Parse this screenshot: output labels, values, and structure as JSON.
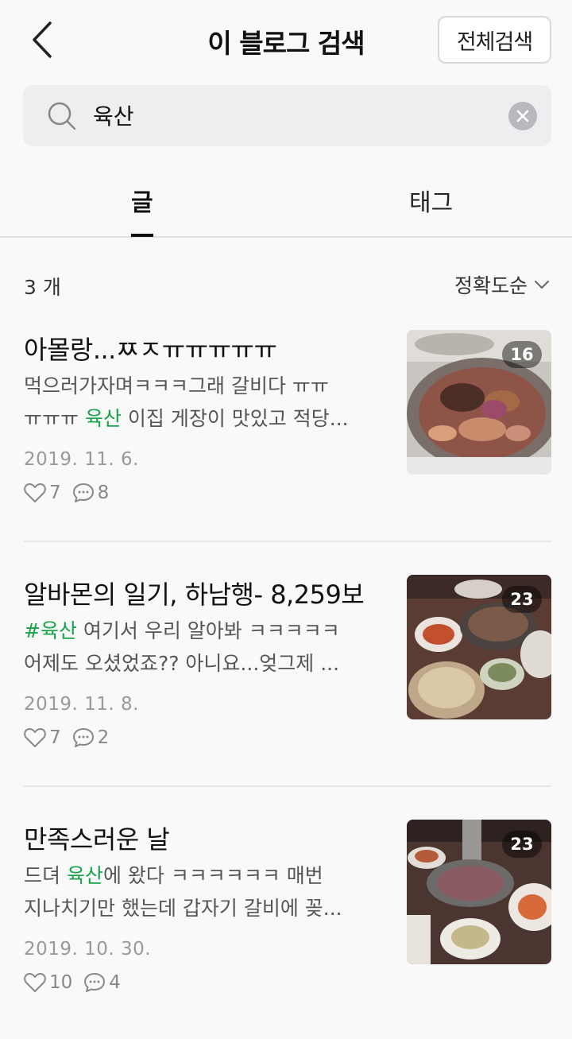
{
  "header": {
    "title": "이 블로그 검색",
    "all_search_label": "전체검색"
  },
  "search": {
    "query": "육산",
    "placeholder": ""
  },
  "tabs": [
    {
      "label": "글",
      "active": true
    },
    {
      "label": "태그",
      "active": false
    }
  ],
  "results": {
    "count_label": "3 개",
    "sort_label": "정확도순"
  },
  "posts": [
    {
      "title": "아몰랑...ㅉㅈㅠㅠㅠㅠㅠ",
      "snippet_line1": "먹으러가자며ㅋㅋㅋ그래 갈비다 ㅠㅠ",
      "snippet_line2_pre": "ㅠㅠㅠ ",
      "snippet_line2_hl": "육산",
      "snippet_line2_post": " 이집 게장이 맛있고 적당...",
      "date": "2019. 11. 6.",
      "likes": "7",
      "comments": "8",
      "photo_count": "16"
    },
    {
      "title": "알바몬의 일기, 하남행- 8,259보",
      "snippet_line1_hl": "#육산",
      "snippet_line1_post": " 여기서 우리 알아봐 ㅋㅋㅋㅋㅋ",
      "snippet_line2": "어제도 오셨었죠?? 아니요...엊그제 ...",
      "date": "2019. 11. 8.",
      "likes": "7",
      "comments": "2",
      "photo_count": "23"
    },
    {
      "title": "만족스러운 날",
      "snippet_line1_pre": "드뎌 ",
      "snippet_line1_hl": "육산",
      "snippet_line1_post": "에 왔다 ㅋㅋㅋㅋㅋㅋ 매번",
      "snippet_line2": "지나치기만 했는데 갑자기 갈비에 꽂...",
      "date": "2019. 10. 30.",
      "likes": "10",
      "comments": "4",
      "photo_count": "23"
    }
  ],
  "icons": {
    "back": "chevron-left-icon",
    "search": "search-icon",
    "clear": "close-circle-icon",
    "sort": "chevron-down-icon",
    "like": "heart-icon",
    "comment": "comment-icon"
  },
  "colors": {
    "highlight": "#16a34a",
    "background": "#f9f9f9",
    "search_bg": "#eceef0"
  }
}
